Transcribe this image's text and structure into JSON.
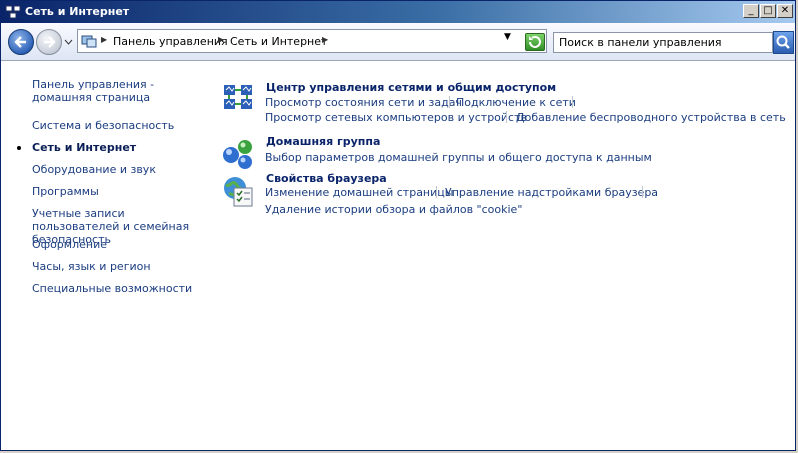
{
  "window": {
    "title": "Сеть и Интернет",
    "buttons": {
      "minimize": "_",
      "maximize": "□",
      "close": "✕"
    }
  },
  "toolbar": {
    "breadcrumb": [
      "Панель управления",
      "Сеть и Интернет"
    ],
    "search_placeholder": "Поиск в панели управления"
  },
  "sidebar": {
    "items": [
      {
        "label": "Панель управления - домашняя страница"
      },
      {
        "label": "Система и безопасность"
      },
      {
        "label": "Сеть и Интернет",
        "active": true
      },
      {
        "label": "Оборудование и звук"
      },
      {
        "label": "Программы"
      },
      {
        "label": "Учетные записи пользователей и семейная безопасность"
      },
      {
        "label": "Оформление"
      },
      {
        "label": "Часы, язык и регион"
      },
      {
        "label": "Специальные возможности"
      }
    ]
  },
  "categories": [
    {
      "title": "Центр управления сетями и общим доступом",
      "icon": "network-center-icon",
      "tasks": [
        "Просмотр состояния сети и задач",
        "Подключение к сети",
        "Просмотр сетевых компьютеров и устройств",
        "Добавление беспроводного устройства в сеть"
      ]
    },
    {
      "title": "Домашняя группа",
      "icon": "homegroup-icon",
      "tasks": [
        "Выбор параметров домашней группы и общего доступа к данным"
      ]
    },
    {
      "title": "Свойства браузера",
      "icon": "internet-options-icon",
      "tasks": [
        "Изменение домашней страницы",
        "Управление надстройками браузера",
        "Удаление истории обзора и файлов \"cookie\""
      ]
    }
  ]
}
